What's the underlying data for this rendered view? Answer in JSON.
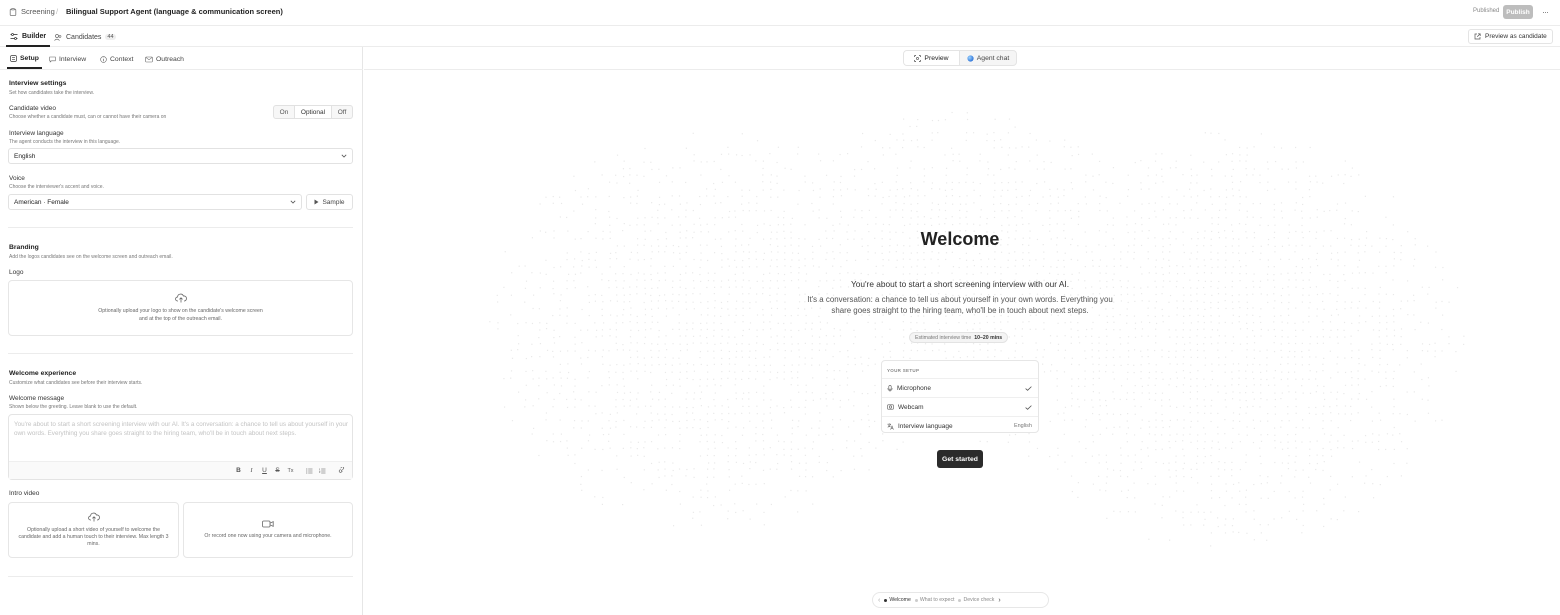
{
  "header": {
    "breadcrumb_root": "Screening",
    "breadcrumb_sep": "/",
    "title": "Bilingual Support Agent (language & communication screen)",
    "status": "Published",
    "publish_label": "Publish",
    "more_label": "···"
  },
  "nav": {
    "builder_label": "Builder",
    "candidates_label": "Candidates",
    "candidates_count": "44",
    "preview_as_candidate": "Preview as candidate"
  },
  "subtabs": {
    "setup": "Setup",
    "interview": "Interview",
    "context": "Context",
    "outreach": "Outreach"
  },
  "settings": {
    "title": "Interview settings",
    "desc": "Set how candidates take the interview.",
    "video_label": "Candidate video",
    "video_desc": "Choose whether a candidate must, can or cannot have their camera on",
    "video_options": [
      "On",
      "Optional",
      "Off"
    ],
    "video_selected": "Off",
    "language_label": "Interview language",
    "language_desc": "The agent conducts the interview in this language.",
    "language_value": "English",
    "voice_label": "Voice",
    "voice_desc": "Choose the interviewer's accent and voice.",
    "voice_value": "American · Female",
    "sample_label": "Sample"
  },
  "branding": {
    "title": "Branding",
    "desc": "Add the logos candidates see on the welcome screen and outreach email.",
    "logo_label": "Logo",
    "logo_upload_line1": "Optionally upload your logo to show on the candidate's welcome screen",
    "logo_upload_line2": "and at the top of the outreach email."
  },
  "welcome_exp": {
    "title": "Welcome experience",
    "desc": "Customize what candidates see before their interview starts.",
    "message_label": "Welcome message",
    "message_desc": "Shown below the greeting. Leave blank to use the default.",
    "message_placeholder": "You're about to start a short screening interview with our AI. It's a conversation: a chance to tell us about yourself in your own words. Everything you share goes straight to the hiring team, who'll be in touch about next steps.",
    "toolbar": [
      "B",
      "I",
      "U",
      "S",
      "Tx"
    ],
    "intro_label": "Intro video",
    "intro_upload_text": "Optionally upload a short video of yourself to welcome the candidate and add a human touch to their interview. Max length 3 mins.",
    "intro_record_text": "Or record one now using your camera and microphone."
  },
  "preview": {
    "tab_preview": "Preview",
    "tab_agent_chat": "Agent chat",
    "welcome_title": "Welcome",
    "welcome_sub": "You're about to start a short screening interview with our AI.",
    "welcome_body": "It's a conversation: a chance to tell us about yourself in your own words. Everything you share goes straight to the hiring team, who'll be in touch about next steps.",
    "est_label": "Estimated interview time",
    "est_value": "10–20 mins",
    "setup_header": "YOUR SETUP",
    "setup_rows": [
      {
        "label": "Microphone",
        "icon": "microphone-icon",
        "status": "check"
      },
      {
        "label": "Webcam",
        "icon": "webcam-icon",
        "status": "check"
      },
      {
        "label": "Interview language",
        "icon": "language-icon",
        "value": "English"
      }
    ],
    "get_started": "Get started",
    "steps": [
      "Welcome",
      "What to expect",
      "Device check"
    ]
  }
}
